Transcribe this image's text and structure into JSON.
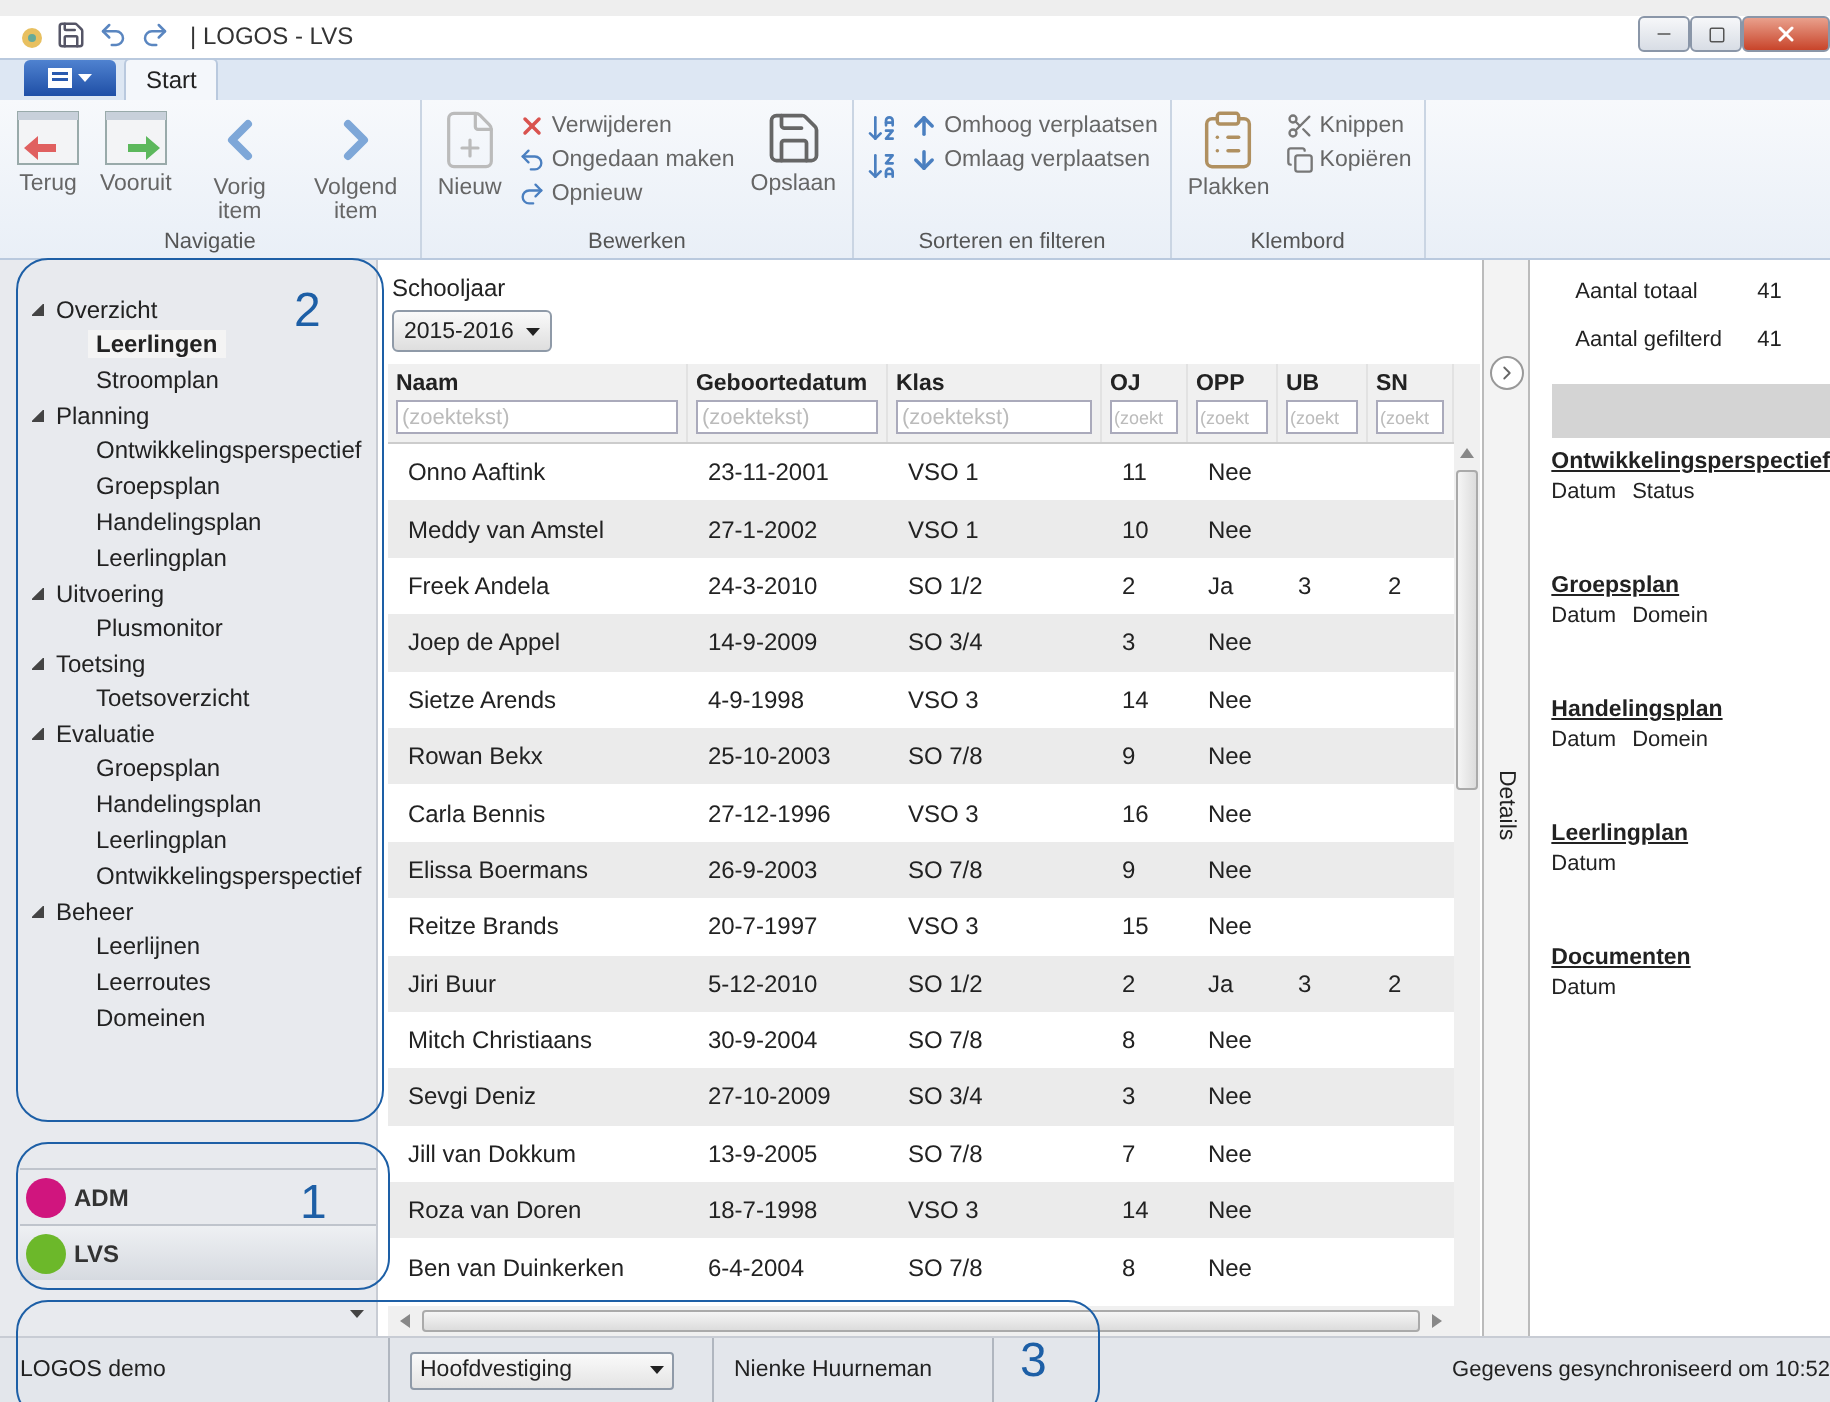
{
  "window": {
    "title": "| LOGOS - LVS"
  },
  "tabs": [
    {
      "label": "Start",
      "selected": true
    }
  ],
  "ribbon": [
    {
      "label": "Navigatie",
      "items": [
        {
          "label": "Terug",
          "kind": "large"
        },
        {
          "label": "Vooruit",
          "kind": "large"
        },
        {
          "label": "Vorig item",
          "kind": "large"
        },
        {
          "label": "Volgend item",
          "kind": "large"
        }
      ]
    },
    {
      "label": "Bewerken",
      "items": [
        {
          "label": "Nieuw",
          "kind": "large"
        },
        {
          "label": "Verwijderen",
          "kind": "small"
        },
        {
          "label": "Ongedaan maken",
          "kind": "small"
        },
        {
          "label": "Opnieuw",
          "kind": "small"
        },
        {
          "label": "Opslaan",
          "kind": "large"
        }
      ]
    },
    {
      "label": "Sorteren en filteren",
      "items": [
        {
          "kind": "icon"
        },
        {
          "kind": "icon"
        },
        {
          "label": "Omhoog verplaatsen",
          "kind": "small"
        },
        {
          "label": "Omlaag verplaatsen",
          "kind": "small"
        }
      ]
    },
    {
      "label": "Klembord",
      "items": [
        {
          "label": "Plakken",
          "kind": "large"
        },
        {
          "label": "Knippen",
          "kind": "small"
        },
        {
          "label": "Kopiëren",
          "kind": "small"
        }
      ]
    }
  ],
  "navigation": [
    {
      "label": "Overzicht",
      "expanded": true,
      "children": [
        {
          "label": "Leerlingen",
          "selected": true
        },
        {
          "label": "Stroomplan",
          "selected": false
        }
      ]
    },
    {
      "label": "Planning",
      "expanded": true,
      "children": [
        {
          "label": "Ontwikkelingsperspectief",
          "selected": false
        },
        {
          "label": "Groepsplan",
          "selected": false
        },
        {
          "label": "Handelingsplan",
          "selected": false
        },
        {
          "label": "Leerlingplan",
          "selected": false
        }
      ]
    },
    {
      "label": "Uitvoering",
      "expanded": true,
      "children": [
        {
          "label": "Plusmonitor",
          "selected": false
        }
      ]
    },
    {
      "label": "Toetsing",
      "expanded": true,
      "children": [
        {
          "label": "Toetsoverzicht",
          "selected": false
        }
      ]
    },
    {
      "label": "Evaluatie",
      "expanded": true,
      "children": [
        {
          "label": "Groepsplan",
          "selected": false
        },
        {
          "label": "Handelingsplan",
          "selected": false
        },
        {
          "label": "Leerlingplan",
          "selected": false
        },
        {
          "label": "Ontwikkelingsperspectief",
          "selected": false
        }
      ]
    },
    {
      "label": "Beheer",
      "expanded": true,
      "children": [
        {
          "label": "Leerlijnen",
          "selected": false
        },
        {
          "label": "Leerroutes",
          "selected": false
        },
        {
          "label": "Domeinen",
          "selected": false
        }
      ]
    }
  ],
  "modules": [
    {
      "label": "ADM",
      "color": "#d0157e",
      "selected": false
    },
    {
      "label": "LVS",
      "color": "#6cb82a",
      "selected": true
    }
  ],
  "filter": {
    "label": "Schooljaar",
    "value": "2015-2016"
  },
  "table": {
    "columns": [
      {
        "label": "Naam",
        "placeholder": "(zoektekst)"
      },
      {
        "label": "Geboortedatum",
        "placeholder": "(zoektekst)"
      },
      {
        "label": "Klas",
        "placeholder": "(zoektekst)"
      },
      {
        "label": "OJ",
        "placeholder": "(zoekt"
      },
      {
        "label": "OPP",
        "placeholder": "(zoekt"
      },
      {
        "label": "UB",
        "placeholder": "(zoekt"
      },
      {
        "label": "SN",
        "placeholder": "(zoekt"
      }
    ],
    "rows": [
      [
        "Onno Aaftink",
        "23-11-2001",
        "VSO 1",
        "11",
        "Nee"
      ],
      [
        "Meddy van Amstel",
        "27-1-2002",
        "VSO 1",
        "10",
        "Nee"
      ],
      [
        "Freek Andela",
        "24-3-2010",
        "SO 1/2",
        "2",
        "Ja",
        "3",
        "2"
      ],
      [
        "Joep de Appel",
        "14-9-2009",
        "SO 3/4",
        "3",
        "Nee"
      ],
      [
        "Sietze Arends",
        "4-9-1998",
        "VSO 3",
        "14",
        "Nee"
      ],
      [
        "Rowan Bekx",
        "25-10-2003",
        "SO 7/8",
        "9",
        "Nee"
      ],
      [
        "Carla Bennis",
        "27-12-1996",
        "VSO 3",
        "16",
        "Nee"
      ],
      [
        "Elissa Boermans",
        "26-9-2003",
        "SO 7/8",
        "9",
        "Nee"
      ],
      [
        "Reitze Brands",
        "20-7-1997",
        "VSO 3",
        "15",
        "Nee"
      ],
      [
        "Jiri Buur",
        "5-12-2010",
        "SO 1/2",
        "2",
        "Ja",
        "3",
        "2"
      ],
      [
        "Mitch Christiaans",
        "30-9-2004",
        "SO 7/8",
        "8",
        "Nee"
      ],
      [
        "Sevgi Deniz",
        "27-10-2009",
        "SO 3/4",
        "3",
        "Nee"
      ],
      [
        "Jill van Dokkum",
        "13-9-2005",
        "SO 7/8",
        "7",
        "Nee"
      ],
      [
        "Roza van Doren",
        "18-7-1998",
        "VSO 3",
        "14",
        "Nee"
      ],
      [
        "Ben van Duinkerken",
        "6-4-2004",
        "SO 7/8",
        "8",
        "Nee"
      ]
    ]
  },
  "details": {
    "label": "Details",
    "counts": [
      {
        "label": "Aantal totaal",
        "value": "41"
      },
      {
        "label": "Aantal gefilterd",
        "value": "41"
      }
    ],
    "sections": [
      {
        "title": "Ontwikkelingsperspectief",
        "fields": [
          "Datum",
          "Status"
        ]
      },
      {
        "title": "Groepsplan",
        "fields": [
          "Datum",
          "Domein"
        ]
      },
      {
        "title": "Handelingsplan",
        "fields": [
          "Datum",
          "Domein"
        ]
      },
      {
        "title": "Leerlingplan",
        "fields": [
          "Datum"
        ]
      },
      {
        "title": "Documenten",
        "fields": [
          "Datum"
        ]
      }
    ]
  },
  "status_bar": {
    "environment": "LOGOS demo",
    "location": "Hoofdvestiging",
    "user": "Nienke Huurneman",
    "sync": "Gegevens gesynchroniseerd om 10:52"
  },
  "annotations": [
    {
      "label": "2"
    },
    {
      "label": "1"
    },
    {
      "label": "3"
    }
  ]
}
